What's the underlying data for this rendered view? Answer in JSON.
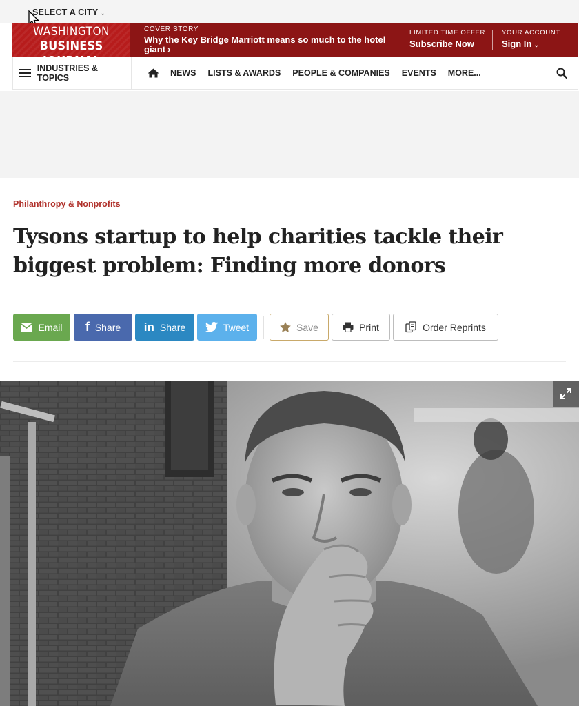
{
  "top_bar": {
    "city_select_label": "SELECT A CITY",
    "city_select_chevron": "⌄"
  },
  "masthead": {
    "logo_line1": "WASHINGTON",
    "logo_line2": "BUSINESS JOURNAL",
    "cover_label": "COVER STORY",
    "cover_headline": "Why the Key Bridge Marriott means so much to the hotel giant",
    "cover_arrow": "›",
    "offer_label": "LIMITED TIME OFFER",
    "offer_link": "Subscribe Now",
    "account_label": "YOUR ACCOUNT",
    "account_link": "Sign In",
    "account_chevron": "⌄",
    "colors": {
      "bar": "#8c1515",
      "logo": "#b71c1c"
    }
  },
  "nav": {
    "industries_label": "INDUSTRIES & TOPICS",
    "items": [
      "NEWS",
      "LISTS & AWARDS",
      "PEOPLE & COMPANIES",
      "EVENTS",
      "MORE..."
    ],
    "home_icon": "home-icon",
    "search_icon": "search-icon"
  },
  "article": {
    "category": "Philanthropy & Nonprofits",
    "headline": "Tysons startup to help charities tackle their biggest problem: Finding more donors",
    "category_color": "#b0312b"
  },
  "share_buttons": {
    "email": "Email",
    "facebook": "Share",
    "linkedin": "Share",
    "twitter": "Tweet",
    "save": "Save",
    "print": "Print",
    "reprints": "Order Reprints",
    "colors": {
      "email": "#6aa84f",
      "facebook": "#4a69ad",
      "linkedin": "#2b88c2",
      "twitter": "#5cb1ec",
      "save_border": "#c9a96a"
    }
  },
  "photo": {
    "description_icon": "expand-icon"
  }
}
